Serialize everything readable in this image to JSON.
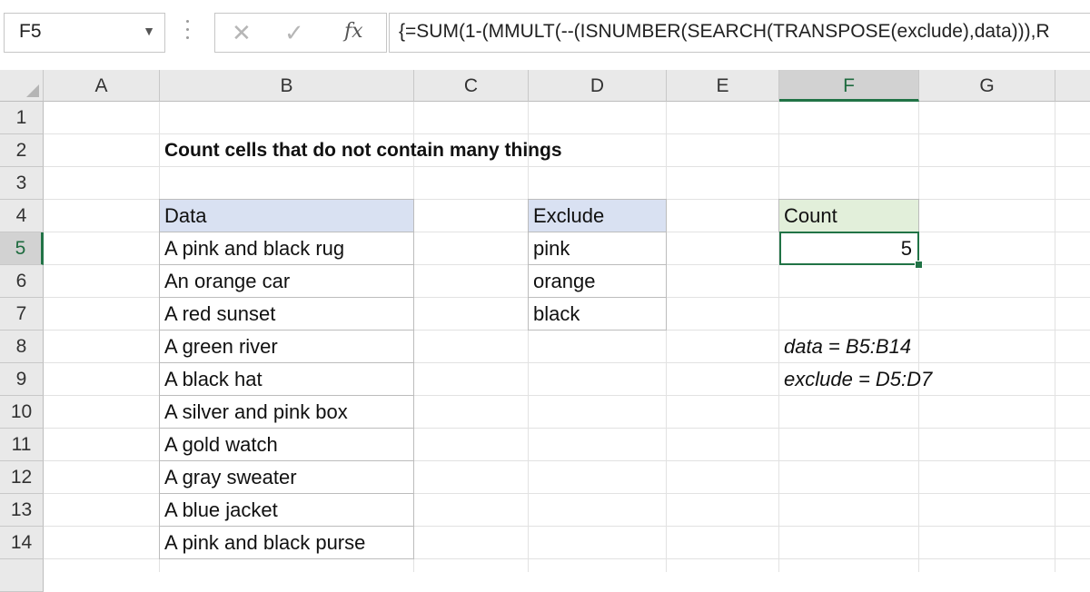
{
  "formula_bar": {
    "name_box": "F5",
    "formula": "{=SUM(1-(MMULT(--(ISNUMBER(SEARCH(TRANSPOSE(exclude),data))),R"
  },
  "columns": [
    "A",
    "B",
    "C",
    "D",
    "E",
    "F",
    "G"
  ],
  "rows": [
    "1",
    "2",
    "3",
    "4",
    "5",
    "6",
    "7",
    "8",
    "9",
    "10",
    "11",
    "12",
    "13",
    "14"
  ],
  "title": "Count cells that do not contain many things",
  "data_table": {
    "header": "Data",
    "items": [
      "A pink and black rug",
      "An orange car",
      "A red sunset",
      "A green river",
      "A black hat",
      "A silver and pink box",
      "A gold watch",
      "A gray sweater",
      "A blue jacket",
      "A pink and black purse"
    ]
  },
  "exclude_table": {
    "header": "Exclude",
    "items": [
      "pink",
      "orange",
      "black"
    ]
  },
  "count": {
    "header": "Count",
    "value": "5"
  },
  "named_ranges": [
    "data = B5:B14",
    "exclude = D5:D7"
  ],
  "colors": {
    "accent": "#217346",
    "table_header": "#d9e1f2",
    "count_header": "#e2efda"
  }
}
